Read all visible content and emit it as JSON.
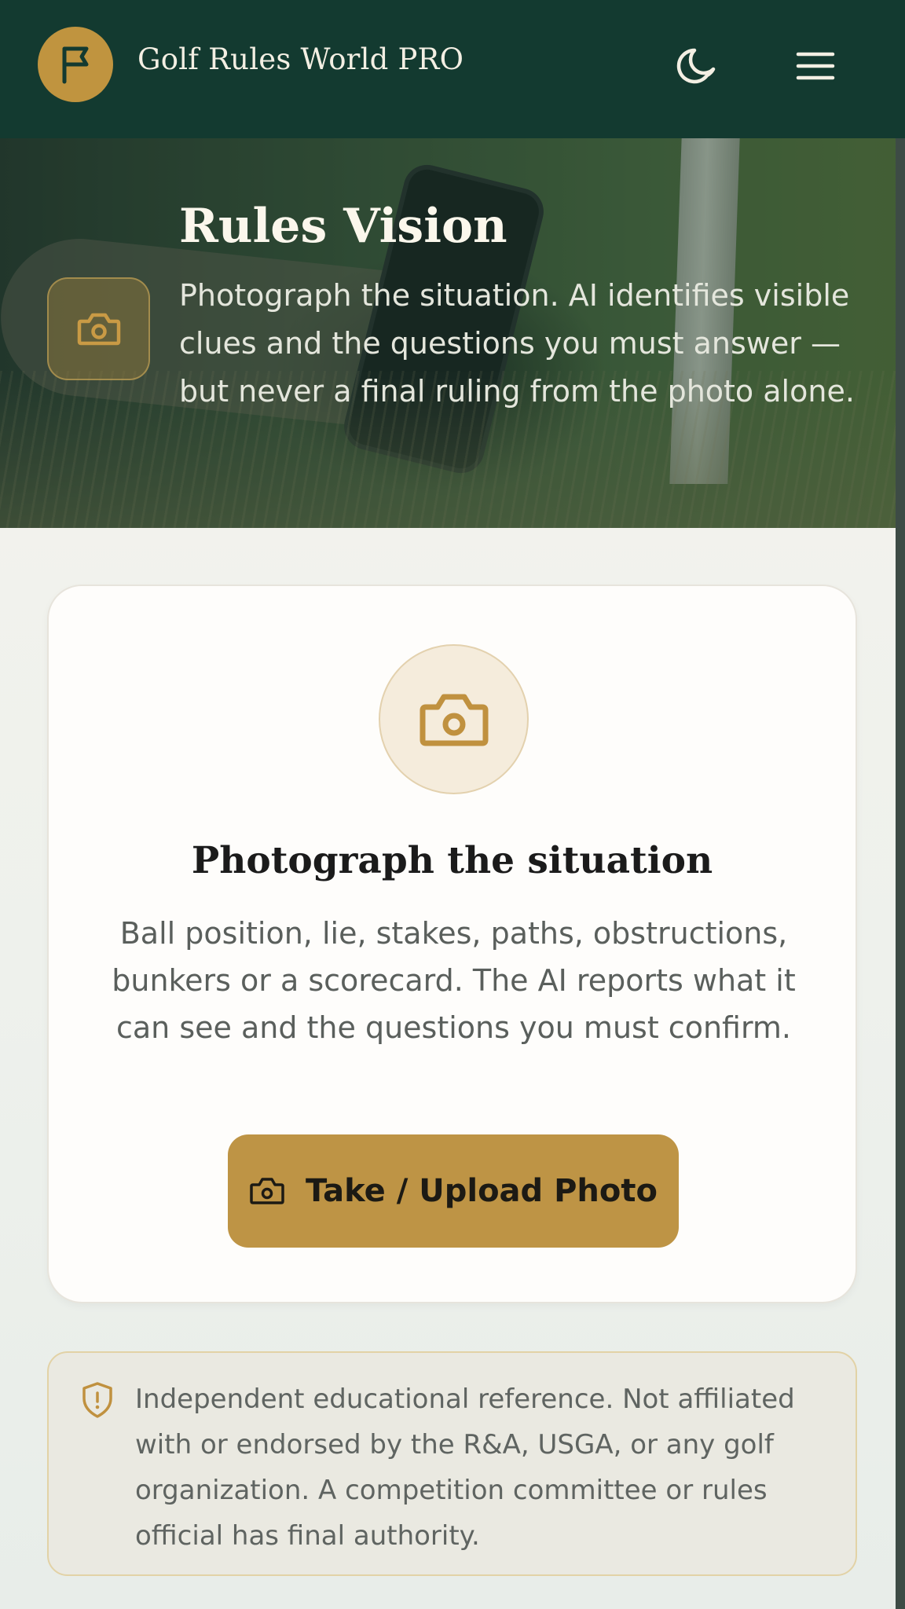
{
  "header": {
    "app_title": "Golf Rules World PRO",
    "logo_icon": "flag-icon",
    "theme_icon": "moon-icon",
    "menu_icon": "hamburger-menu-icon"
  },
  "hero": {
    "title": "Rules Vision",
    "description": "Photograph the situation. AI identifies visible clues and the questions you must answer — but never a final ruling from the photo alone.",
    "icon": "camera-icon"
  },
  "card": {
    "icon": "camera-icon",
    "title": "Photograph the situation",
    "description": "Ball position, lie, stakes, paths, obstructions, bunkers or a scorecard. The AI reports what it can see and the questions you must confirm.",
    "button_label": "Take / Upload Photo",
    "button_icon": "camera-icon"
  },
  "disclaimer": {
    "icon": "shield-alert-icon",
    "text": "Independent educational reference. Not affiliated with or endorsed by the R&A, USGA, or any golf organization. A competition committee or rules official has final authority."
  },
  "colors": {
    "header_bg": "#133a30",
    "accent_gold": "#be9445",
    "card_bg": "#fefdfb",
    "page_bg": "#f6f4ee"
  }
}
